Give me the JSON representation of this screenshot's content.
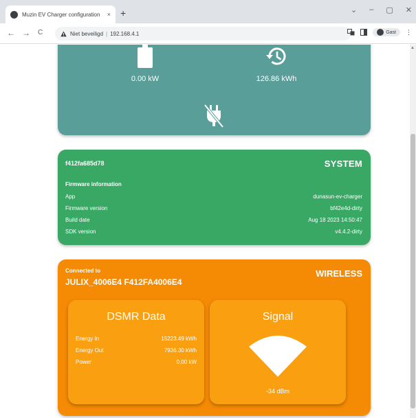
{
  "browser": {
    "tab_title": "Muzin EV Charger configuration",
    "tab_close": "×",
    "new_tab": "+",
    "win_min": "‒",
    "win_max": "▢",
    "win_close": "✕",
    "win_chevron": "⌄",
    "back": "←",
    "forward": "→",
    "reload": "C",
    "security_label": "Niet beveiligd",
    "url": "192.168.4.1",
    "profile_label": "Gast",
    "menu": "⋮"
  },
  "power_card": {
    "power_value": "0.00 kW",
    "session_value": "126.86 kWh",
    "icons": [
      "battery-icon",
      "history-icon",
      "plug-off-icon"
    ]
  },
  "system_card": {
    "device_id": "f412fa685d78",
    "title": "SYSTEM",
    "firmware_heading": "Firmware information",
    "rows": [
      {
        "label": "App",
        "value": "dunasun-ev-charger"
      },
      {
        "label": "Firmware version",
        "value": "bf42e4d-dirty"
      },
      {
        "label": "Build date",
        "value": "Aug 18 2023 14:50:47"
      },
      {
        "label": "SDK version",
        "value": "v4.4.2-dirty"
      }
    ]
  },
  "wireless_card": {
    "connected_label": "Connected to",
    "ssid": "JULIX_4006E4 F412FA4006E4",
    "title": "WIRELESS",
    "dsmr": {
      "title": "DSMR Data",
      "rows": [
        {
          "label": "Energy In",
          "value": "15223.49 kWh"
        },
        {
          "label": "Energy Out",
          "value": "7936.30 kWh"
        },
        {
          "label": "Power",
          "value": "0.00 kW"
        }
      ]
    },
    "signal": {
      "title": "Signal",
      "value": "-34 dBm"
    }
  },
  "colors": {
    "power_card": "#5a9e9a",
    "system_card": "#3aa865",
    "wireless_card": "#f58a05",
    "wireless_inner": "#f99f10"
  }
}
